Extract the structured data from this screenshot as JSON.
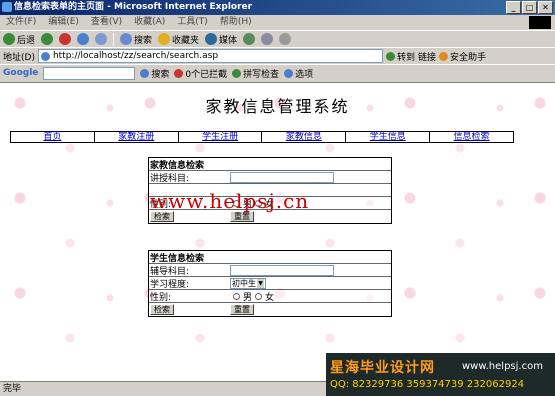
{
  "window": {
    "title": "信息检索表单的主页面 - Microsoft Internet Explorer"
  },
  "menu": [
    "文件(F)",
    "编辑(E)",
    "查看(V)",
    "收藏(A)",
    "工具(T)",
    "帮助(H)"
  ],
  "toolbar": {
    "back": "后退",
    "search": "搜索",
    "favorites": "收藏夹",
    "media": "媒体"
  },
  "address": {
    "label": "地址(D)",
    "url": "http://localhost/zz/search/search.asp",
    "go": "转到",
    "links": "链接",
    "security": "安全助手"
  },
  "google": {
    "brand": "Google",
    "search": "搜索",
    "blocked": "0个已拦截",
    "spell": "拼写检查",
    "options": "选项"
  },
  "page": {
    "title": "家教信息管理系统"
  },
  "nav": [
    "首页",
    "家教注册",
    "学生注册",
    "家教信息",
    "学生信息",
    "信息检索"
  ],
  "tutor_form": {
    "heading": "家教信息检索",
    "subject_label": "讲授科目:",
    "gender_label": "性别:",
    "male": "男",
    "female": "女",
    "search_btn": "检索",
    "reset_btn": "重置"
  },
  "student_form": {
    "heading": "学生信息检索",
    "subject_label": "辅导科目:",
    "level_label": "学习程度:",
    "level_value": "初中生",
    "gender_label": "性别:",
    "male": "男",
    "female": "女",
    "search_btn": "检索",
    "reset_btn": "重置"
  },
  "watermark": "www.helpsj.cn",
  "status": "完毕",
  "ad": {
    "name": "星海毕业设计网",
    "url": "www.helpsj.com",
    "qq": "QQ: 82329736  359374739  232062924"
  }
}
